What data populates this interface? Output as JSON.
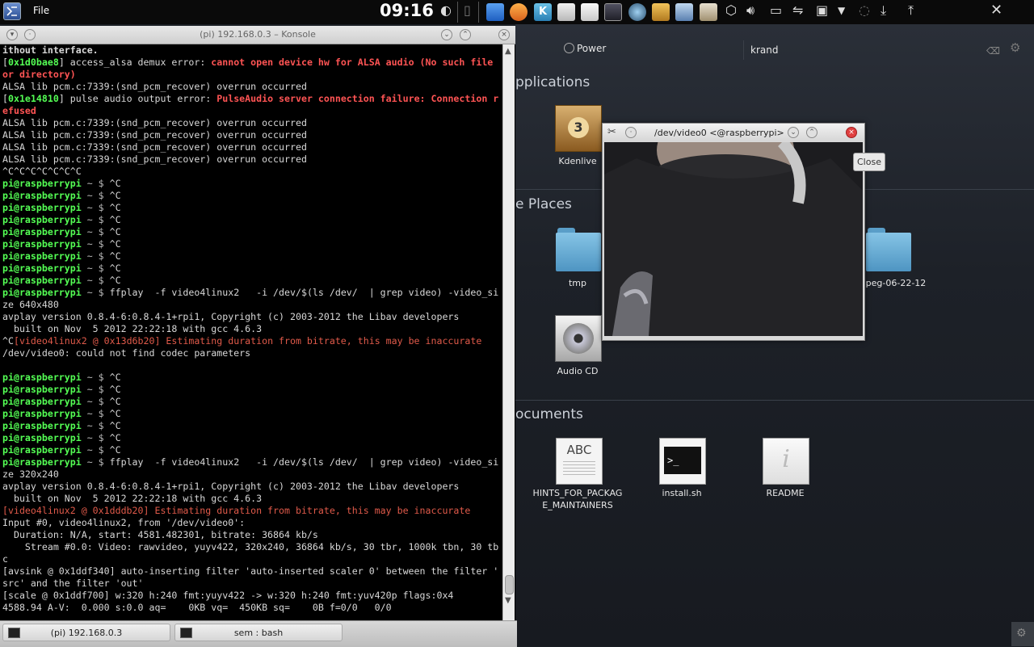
{
  "top_panel": {
    "app_menu_icon": "kde-menu-icon",
    "file_menu": "File",
    "clock": "09:16"
  },
  "desktop": {
    "power_label": "Power",
    "search_value": "krand",
    "sections": {
      "applications": "pplications",
      "places": "e Places",
      "documents": "ocuments"
    },
    "apps": [
      {
        "label": "Kdenlive"
      },
      {
        "label": "Audio CD"
      }
    ],
    "places": [
      {
        "label": "tmp"
      },
      {
        "label": "peg-06-22-12"
      }
    ],
    "documents": [
      {
        "label": "HINTS_FOR_PACKAG\nE_MAINTAINERS",
        "thumb_text": "ABC"
      },
      {
        "label": "install.sh",
        "thumb_text": ">_"
      },
      {
        "label": "README",
        "thumb_text": "i"
      }
    ]
  },
  "konsole": {
    "title": "(pi) 192.168.0.3 – Konsole",
    "lines": [
      [
        [
          "b",
          "ithout interface."
        ]
      ],
      [
        [
          "",
          "["
        ],
        [
          "g",
          "0x1d0bae8"
        ],
        [
          "",
          "] access_alsa demux error: "
        ],
        [
          "r",
          "cannot open device hw for ALSA audio (No such file"
        ]
      ],
      [
        [
          "r",
          "or directory)"
        ]
      ],
      [
        [
          "",
          "ALSA lib pcm.c:7339:(snd_pcm_recover) overrun occurred"
        ]
      ],
      [
        [
          "",
          "["
        ],
        [
          "g",
          "0x1e14810"
        ],
        [
          "",
          "] pulse audio output error: "
        ],
        [
          "r",
          "PulseAudio server connection failure: Connection r"
        ]
      ],
      [
        [
          "r",
          "efused"
        ]
      ],
      [
        [
          "",
          "ALSA lib pcm.c:7339:(snd_pcm_recover) overrun occurred"
        ]
      ],
      [
        [
          "",
          "ALSA lib pcm.c:7339:(snd_pcm_recover) overrun occurred"
        ]
      ],
      [
        [
          "",
          "ALSA lib pcm.c:7339:(snd_pcm_recover) overrun occurred"
        ]
      ],
      [
        [
          "",
          "ALSA lib pcm.c:7339:(snd_pcm_recover) overrun occurred"
        ]
      ],
      [
        [
          "",
          "^C^C^C^C^C^C^C"
        ]
      ],
      [
        [
          "g",
          "pi@raspberrypi"
        ],
        [
          "gy",
          " ~ $ "
        ],
        [
          "",
          "^C"
        ]
      ],
      [
        [
          "g",
          "pi@raspberrypi"
        ],
        [
          "gy",
          " ~ $ "
        ],
        [
          "",
          "^C"
        ]
      ],
      [
        [
          "g",
          "pi@raspberrypi"
        ],
        [
          "gy",
          " ~ $ "
        ],
        [
          "",
          "^C"
        ]
      ],
      [
        [
          "g",
          "pi@raspberrypi"
        ],
        [
          "gy",
          " ~ $ "
        ],
        [
          "",
          "^C"
        ]
      ],
      [
        [
          "g",
          "pi@raspberrypi"
        ],
        [
          "gy",
          " ~ $ "
        ],
        [
          "",
          "^C"
        ]
      ],
      [
        [
          "g",
          "pi@raspberrypi"
        ],
        [
          "gy",
          " ~ $ "
        ],
        [
          "",
          "^C"
        ]
      ],
      [
        [
          "g",
          "pi@raspberrypi"
        ],
        [
          "gy",
          " ~ $ "
        ],
        [
          "",
          "^C"
        ]
      ],
      [
        [
          "g",
          "pi@raspberrypi"
        ],
        [
          "gy",
          " ~ $ "
        ],
        [
          "",
          "^C"
        ]
      ],
      [
        [
          "g",
          "pi@raspberrypi"
        ],
        [
          "gy",
          " ~ $ "
        ],
        [
          "",
          "^C"
        ]
      ],
      [
        [
          "g",
          "pi@raspberrypi"
        ],
        [
          "gy",
          " ~ $ "
        ],
        [
          "",
          "ffplay  -f video4linux2   -i /dev/$(ls /dev/  | grep video) -video_si"
        ]
      ],
      [
        [
          "",
          "ze 640x480"
        ]
      ],
      [
        [
          "",
          "avplay version 0.8.4-6:0.8.4-1+rpi1, Copyright (c) 2003-2012 the Libav developers"
        ]
      ],
      [
        [
          "",
          "  built on Nov  5 2012 22:22:18 with gcc 4.6.3"
        ]
      ],
      [
        [
          "",
          "^C"
        ],
        [
          "rn",
          "[video4linux2 @ 0x13d6b20] Estimating duration from bitrate, this may be inaccurate"
        ]
      ],
      [
        [
          "",
          "/dev/video0: could not find codec parameters"
        ]
      ],
      [
        [
          "",
          ""
        ]
      ],
      [
        [
          "g",
          "pi@raspberrypi"
        ],
        [
          "gy",
          " ~ $ "
        ],
        [
          "",
          "^C"
        ]
      ],
      [
        [
          "g",
          "pi@raspberrypi"
        ],
        [
          "gy",
          " ~ $ "
        ],
        [
          "",
          "^C"
        ]
      ],
      [
        [
          "g",
          "pi@raspberrypi"
        ],
        [
          "gy",
          " ~ $ "
        ],
        [
          "",
          "^C"
        ]
      ],
      [
        [
          "g",
          "pi@raspberrypi"
        ],
        [
          "gy",
          " ~ $ "
        ],
        [
          "",
          "^C"
        ]
      ],
      [
        [
          "g",
          "pi@raspberrypi"
        ],
        [
          "gy",
          " ~ $ "
        ],
        [
          "",
          "^C"
        ]
      ],
      [
        [
          "g",
          "pi@raspberrypi"
        ],
        [
          "gy",
          " ~ $ "
        ],
        [
          "",
          "^C"
        ]
      ],
      [
        [
          "g",
          "pi@raspberrypi"
        ],
        [
          "gy",
          " ~ $ "
        ],
        [
          "",
          "^C"
        ]
      ],
      [
        [
          "g",
          "pi@raspberrypi"
        ],
        [
          "gy",
          " ~ $ "
        ],
        [
          "",
          "ffplay  -f video4linux2   -i /dev/$(ls /dev/  | grep video) -video_si"
        ]
      ],
      [
        [
          "",
          "ze 320x240"
        ]
      ],
      [
        [
          "",
          "avplay version 0.8.4-6:0.8.4-1+rpi1, Copyright (c) 2003-2012 the Libav developers"
        ]
      ],
      [
        [
          "",
          "  built on Nov  5 2012 22:22:18 with gcc 4.6.3"
        ]
      ],
      [
        [
          "rn",
          "[video4linux2 @ 0x1dddb20] Estimating duration from bitrate, this may be inaccurate"
        ]
      ],
      [
        [
          "",
          "Input #0, video4linux2, from '/dev/video0':"
        ]
      ],
      [
        [
          "",
          "  Duration: N/A, start: 4581.482301, bitrate: 36864 kb/s"
        ]
      ],
      [
        [
          "",
          "    Stream #0.0: Video: rawvideo, yuyv422, 320x240, 36864 kb/s, 30 tbr, 1000k tbn, 30 tb"
        ]
      ],
      [
        [
          "",
          "c"
        ]
      ],
      [
        [
          "",
          "[avsink @ 0x1ddf340] auto-inserting filter 'auto-inserted scaler 0' between the filter '"
        ]
      ],
      [
        [
          "",
          "src' and the filter 'out'"
        ]
      ],
      [
        [
          "",
          "[scale @ 0x1ddf700] w:320 h:240 fmt:yuyv422 -> w:320 h:240 fmt:yuv420p flags:0x4"
        ]
      ],
      [
        [
          "",
          "4588.94 A-V:  0.000 s:0.0 aq=    0KB vq=  450KB sq=    0B f=0/0   0/0"
        ]
      ]
    ]
  },
  "taskbar": {
    "tasks": [
      {
        "label": "(pi) 192.168.0.3"
      },
      {
        "label": "sem : bash"
      }
    ]
  },
  "video_window": {
    "title": "/dev/video0 <@raspberrypi>",
    "close_tooltip": "Close"
  }
}
